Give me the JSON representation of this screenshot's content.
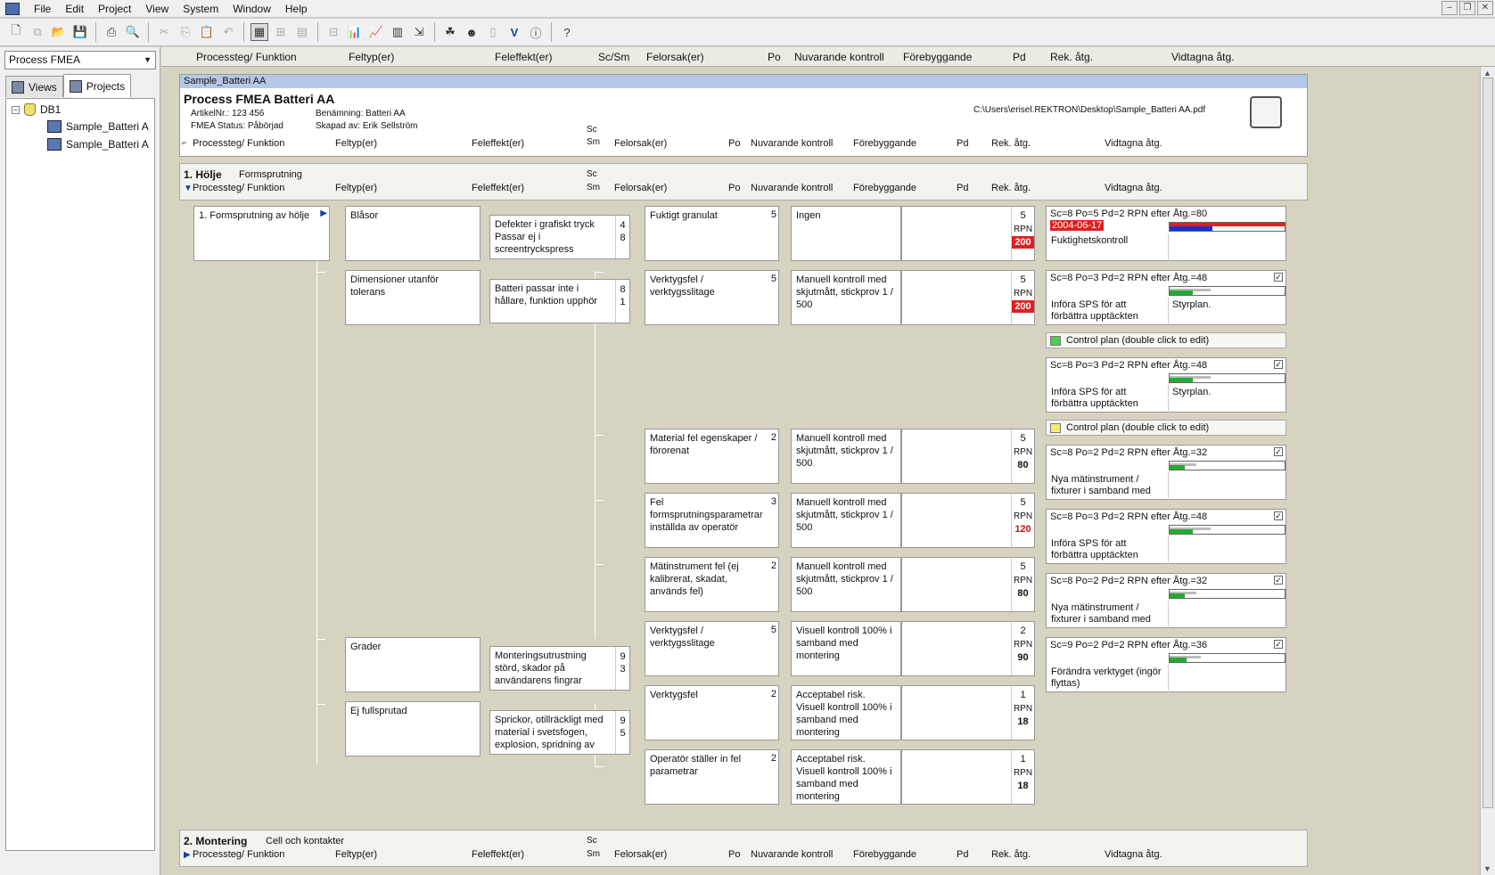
{
  "menubar": {
    "items": [
      "File",
      "Edit",
      "Project",
      "View",
      "System",
      "Window",
      "Help"
    ]
  },
  "left_panel": {
    "combo_value": "Process FMEA",
    "tabs": [
      "Views",
      "Projects"
    ],
    "tree": {
      "root": "DB1",
      "children": [
        "Sample_Batteri A",
        "Sample_Batteri A"
      ]
    }
  },
  "columns": [
    "Processteg/ Funktion",
    "Feltyp(er)",
    "Feleffekt(er)",
    "Sc/Sm",
    "Felorsak(er)",
    "Po",
    "Nuvarande kontroll",
    "Förebyggande",
    "Pd",
    "Rek. åtg.",
    "Vidtagna åtg."
  ],
  "doc": {
    "tab_title": "Sample_Batteri AA",
    "title": "Process FMEA Batteri AA",
    "artikel": "ArtikelNr.: 123 456",
    "status": "FMEA Status: Påbörjad",
    "benamning": "Benämning: Batteri AA",
    "skapad": "Skapad av: Erik Sellström",
    "path": "C:\\Users\\erisel.REKTRON\\Desktop\\Sample_Batteri AA.pdf",
    "sc": "Sc",
    "sm": "Sm"
  },
  "section1": {
    "number_title": "1. Hölje",
    "subtitle": "Formsprutning"
  },
  "section2": {
    "number_title": "2. Montering",
    "subtitle": "Cell och kontakter"
  },
  "hdr": {
    "processteg": "Processteg/ Funktion",
    "feltyp": "Feltyp(er)",
    "feleffekt": "Feleffekt(er)",
    "felorsak": "Felorsak(er)",
    "po": "Po",
    "nuvarande": "Nuvarande kontroll",
    "forebyggande": "Förebyggande",
    "pd": "Pd",
    "rek": "Rek. åtg.",
    "vidtagna": "Vidtagna åtg."
  },
  "process_step": "1. Formsprutning av hölje",
  "failure_modes": [
    {
      "name": "Blåsor",
      "effect": "Defekter i grafiskt tryck Passar ej i screentryckspress",
      "sc": "4",
      "sm": "8"
    },
    {
      "name": "Dimensioner utanför tolerans",
      "effect": "Batteri passar inte i hållare, funktion upphör",
      "sc": "8",
      "sm": "1"
    },
    {
      "name": "Grader",
      "effect": "Monteringsutrustning störd, skador på användarens fingrar",
      "sc": "9",
      "sm": "3"
    },
    {
      "name": "Ej fullsprutad",
      "effect": "Sprickor, otillräckligt med material i svetsfogen, explosion, spridning av",
      "sc": "9",
      "sm": "5"
    }
  ],
  "causes": [
    {
      "cause": "Fuktigt granulat",
      "po": "5",
      "control": "Ingen",
      "pd": "5",
      "rpn_label": "RPN",
      "rpn": "200"
    },
    {
      "cause": "Verktygsfel / verktygsslitage",
      "po": "5",
      "control": "Manuell kontroll med skjutmått, stickprov 1 / 500",
      "pd": "5",
      "rpn_label": "RPN",
      "rpn": "200"
    },
    {
      "cause": "Material fel egenskaper / förorenat",
      "po": "2",
      "control": "Manuell kontroll med skjutmått, stickprov 1 / 500",
      "pd": "5",
      "rpn_label": "RPN",
      "rpn": "80"
    },
    {
      "cause": "Fel formsprutningsparametrar inställda av operatör",
      "po": "3",
      "control": "Manuell kontroll med skjutmått, stickprov 1 / 500",
      "pd": "5",
      "rpn_label": "RPN",
      "rpn": "120"
    },
    {
      "cause": "Mätinstrument fel (ej kalibrerat, skadat, används fel)",
      "po": "2",
      "control": "Manuell kontroll med skjutmått, stickprov 1 / 500",
      "pd": "5",
      "rpn_label": "RPN",
      "rpn": "80"
    },
    {
      "cause": "Verktygsfel / verktygsslitage",
      "po": "5",
      "control": "Visuell kontroll 100% i samband med montering",
      "pd": "2",
      "rpn_label": "RPN",
      "rpn": "90"
    },
    {
      "cause": "Verktygsfel",
      "po": "2",
      "control": "Acceptabel risk. Visuell kontroll 100% i samband med montering",
      "pd": "1",
      "rpn_label": "RPN",
      "rpn": "18"
    },
    {
      "cause": "Operatör ställer in fel parametrar",
      "po": "2",
      "control": "Acceptabel risk. Visuell kontroll 100% i samband med montering",
      "pd": "1",
      "rpn_label": "RPN",
      "rpn": "18"
    }
  ],
  "recommendations": [
    {
      "header": "Sc=8 Po=5 Pd=2 RPN efter Åtg.=80",
      "date": "2004-06-17",
      "action": "Fuktighetskontroll",
      "resp": "",
      "progress": 0.0,
      "checked": false
    },
    {
      "header": "Sc=8 Po=3 Pd=2 RPN efter Åtg.=48",
      "action": "Införa SPS för att förbättra upptäckten",
      "resp": "Styrplan.",
      "progress": 0.2,
      "checked": true
    },
    {
      "header": "Sc=8 Po=3 Pd=2 RPN efter Åtg.=48",
      "action": "Införa SPS för att förbättra upptäckten",
      "resp": "Styrplan.",
      "progress": 0.2,
      "checked": true
    },
    {
      "header": "Sc=8 Po=2 Pd=2 RPN efter Åtg.=32",
      "action": "Nya mätinstrument / fixturer i samband med",
      "resp": "",
      "progress": 0.13,
      "checked": true
    },
    {
      "header": "Sc=8 Po=3 Pd=2 RPN efter Åtg.=48",
      "action": "Införa SPS för att förbättra upptäckten",
      "resp": "",
      "progress": 0.2,
      "checked": true
    },
    {
      "header": "Sc=8 Po=2 Pd=2 RPN efter Åtg.=32",
      "action": "Nya mätinstrument / fixturer i samband med",
      "resp": "",
      "progress": 0.13,
      "checked": true
    },
    {
      "header": "Sc=9 Po=2 Pd=2 RPN efter Åtg.=36",
      "action": "Förändra verktyget (ingör flyttas)",
      "resp": "",
      "progress": 0.15,
      "checked": true
    }
  ],
  "control_plans": [
    {
      "label": "Control plan (double click to edit)",
      "color": "#4ecb4e"
    },
    {
      "label": "Control plan (double click to edit)",
      "color": "#f0ee70"
    }
  ],
  "colors": {
    "rpn_high_bg": "#e02020",
    "rpn_high_text": "#d01010",
    "progress_green": "#22aa33",
    "progress_blue": "#1a2fd0",
    "progress_red": "#e02020",
    "title_blue": "#b4c8e6"
  }
}
